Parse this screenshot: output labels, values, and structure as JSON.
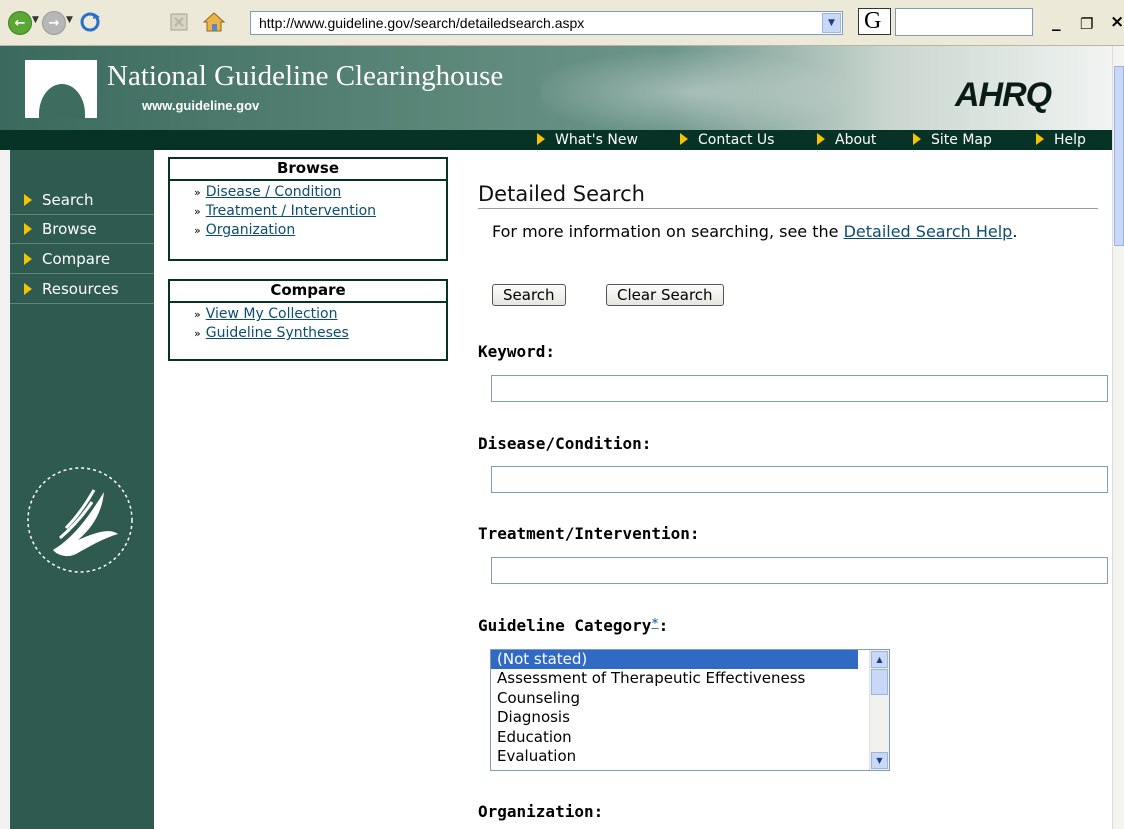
{
  "browser": {
    "address": "http://www.guideline.gov/search/detailedsearch.aspx",
    "google_glyph": "G"
  },
  "header": {
    "title": "National Guideline Clearinghouse",
    "url": "www.guideline.gov",
    "agency": "AHRQ"
  },
  "topnav": [
    "What's New",
    "Contact Us",
    "About",
    "Site Map",
    "Help"
  ],
  "sidebar": [
    "Search",
    "Browse",
    "Compare",
    "Resources"
  ],
  "browse": {
    "title": "Browse",
    "items": [
      "Disease / Condition",
      "Treatment / Intervention",
      "Organization"
    ]
  },
  "compare": {
    "title": "Compare",
    "items": [
      "View My Collection",
      "Guideline Syntheses"
    ]
  },
  "main": {
    "title": "Detailed Search",
    "help_prefix": "For more information on searching, see the ",
    "help_link": "Detailed Search Help",
    "help_suffix": ".",
    "search_button": "Search",
    "clear_button": "Clear Search",
    "keyword_label": "Keyword:",
    "disease_label": "Disease/Condition:",
    "treatment_label": "Treatment/Intervention:",
    "category_label": "Guideline Category",
    "category_marker": "*",
    "category_colon": ":",
    "category_options": [
      "(Not stated)",
      "Assessment of Therapeutic Effectiveness",
      "Counseling",
      "Diagnosis",
      "Education",
      "Evaluation"
    ],
    "category_selected": "(Not stated)",
    "organization_label": "Organization:"
  }
}
